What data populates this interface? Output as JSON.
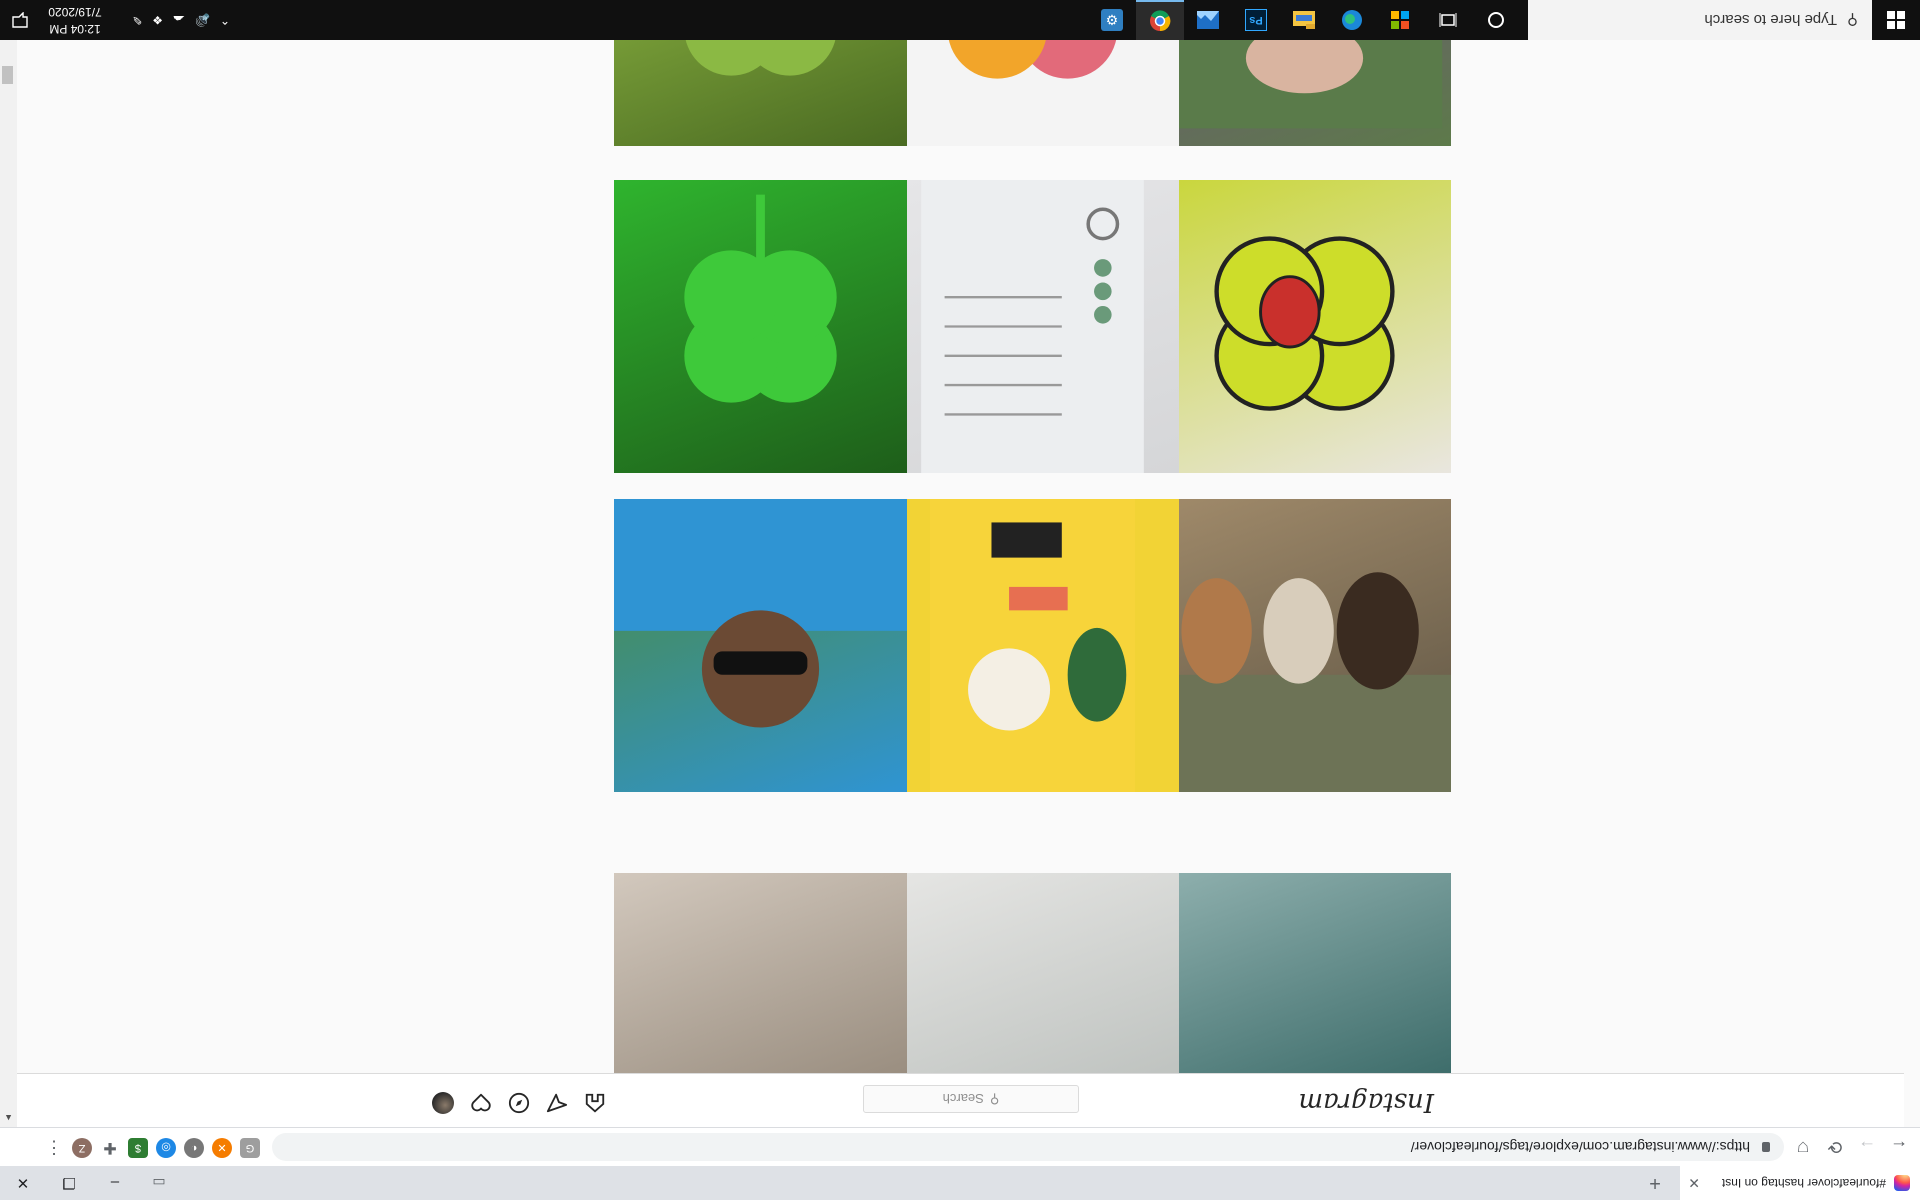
{
  "browser": {
    "tab_title": "#fourleafclover hashtag on Inst",
    "tab_close": "✕",
    "new_tab": "+",
    "window_controls": {
      "minimize": "–",
      "restore": "❐",
      "close": "✕"
    },
    "url": "https://www.instagram.com/explore/tags/fourleafclover/",
    "back": "←",
    "forward": "→",
    "reload": "⟳",
    "menu": "⋮",
    "profile_initial": "Z"
  },
  "instagram": {
    "logo": "Instagram",
    "search_placeholder": "Search"
  },
  "taskbar": {
    "search_placeholder": "Type here to search",
    "time": "12:04 PM",
    "date": "7/19/2020"
  },
  "posts": [
    {
      "desc": "teal water clover (partial)",
      "colors": [
        "#3e6d6b",
        "#8fb0ae"
      ]
    },
    {
      "desc": "white decor (partial)",
      "colors": [
        "#bfc3c0",
        "#e6e6e4"
      ]
    },
    {
      "desc": "clover on wood (partial)",
      "colors": [
        "#9a8e80",
        "#d2c8bd"
      ]
    },
    {
      "desc": "dogs on grass",
      "colors": [
        "#5b5242",
        "#a08a6a"
      ]
    },
    {
      "desc": "yellow flatlay travel",
      "colors": [
        "#f2d335",
        "#f2d335"
      ]
    },
    {
      "desc": "man with sunglasses",
      "colors": [
        "#2f94d3",
        "#4c8a3a"
      ]
    },
    {
      "desc": "stained glass ladybug clover",
      "colors": [
        "#e9e6df",
        "#c9d63a"
      ]
    },
    {
      "desc": "good luck keyring",
      "colors": [
        "#d5d6d8",
        "#e6e6e8"
      ]
    },
    {
      "desc": "four leaf clover",
      "colors": [
        "#1e5e1a",
        "#2fb42e"
      ]
    },
    {
      "desc": "hand picking clover",
      "colors": [
        "#5d7a4a",
        "#6a5b70"
      ]
    },
    {
      "desc": "quilled paper clover",
      "colors": [
        "#f4f4f4",
        "#f4f4f4"
      ]
    },
    {
      "desc": "clover patch",
      "colors": [
        "#4a6a22",
        "#7da33a"
      ]
    }
  ]
}
